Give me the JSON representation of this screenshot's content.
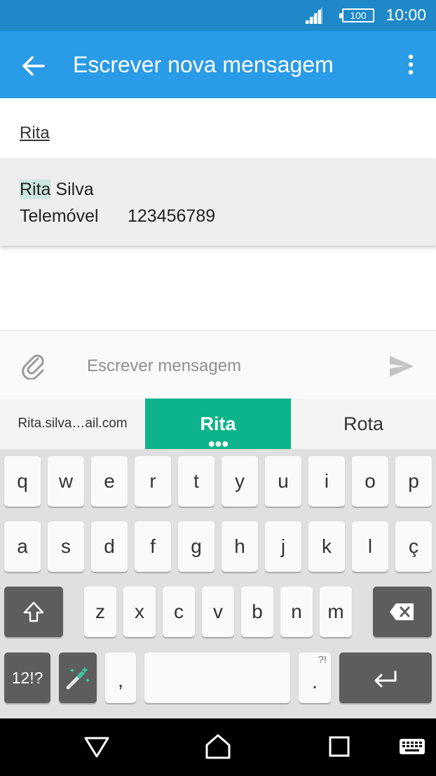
{
  "status": {
    "battery": "100",
    "time": "10:00"
  },
  "appbar": {
    "title": "Escrever nova mensagem"
  },
  "recipient": {
    "value": "Rita"
  },
  "suggestion": {
    "name_match": "Rita",
    "name_rest": " Silva",
    "phone_label": "Telemóvel",
    "phone_number": "123456789"
  },
  "compose": {
    "placeholder": "Escrever mensagem"
  },
  "word_suggestions": [
    "Rita.silva…ail.com",
    "Rita",
    "Rota"
  ],
  "keyboard": {
    "row1": [
      "q",
      "w",
      "e",
      "r",
      "t",
      "y",
      "u",
      "i",
      "o",
      "p"
    ],
    "row2": [
      "a",
      "s",
      "d",
      "f",
      "g",
      "h",
      "j",
      "k",
      "l",
      "ç"
    ],
    "row3": [
      "z",
      "x",
      "c",
      "v",
      "b",
      "n",
      "m"
    ],
    "symbols_label": "12!?",
    "comma": ",",
    "period": ".",
    "period_hint": "?!"
  },
  "colors": {
    "status_bar": "#1e88c8",
    "app_bar": "#2a9be6",
    "suggestion_accent": "#0db38a"
  }
}
